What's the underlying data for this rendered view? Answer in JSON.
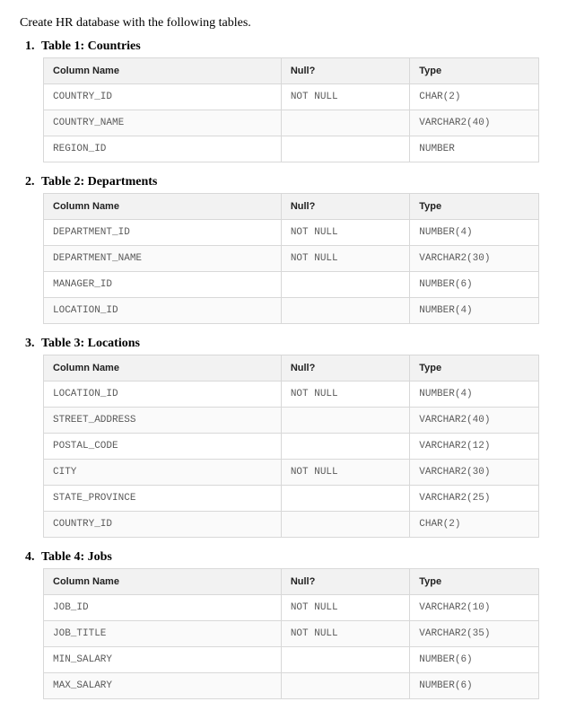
{
  "intro": "Create HR database with the following tables.",
  "tables": [
    {
      "number": "1.",
      "title": "Table 1: Countries",
      "headers": {
        "name": "Column Name",
        "null": "Null?",
        "type": "Type"
      },
      "rows": [
        {
          "name": "COUNTRY_ID",
          "null": "NOT NULL",
          "type": "CHAR(2)"
        },
        {
          "name": "COUNTRY_NAME",
          "null": "",
          "type": "VARCHAR2(40)"
        },
        {
          "name": "REGION_ID",
          "null": "",
          "type": "NUMBER"
        }
      ]
    },
    {
      "number": "2.",
      "title": "Table 2: Departments",
      "headers": {
        "name": "Column Name",
        "null": "Null?",
        "type": "Type"
      },
      "rows": [
        {
          "name": "DEPARTMENT_ID",
          "null": "NOT NULL",
          "type": "NUMBER(4)"
        },
        {
          "name": "DEPARTMENT_NAME",
          "null": "NOT NULL",
          "type": "VARCHAR2(30)"
        },
        {
          "name": "MANAGER_ID",
          "null": "",
          "type": "NUMBER(6)"
        },
        {
          "name": "LOCATION_ID",
          "null": "",
          "type": "NUMBER(4)"
        }
      ]
    },
    {
      "number": "3.",
      "title": "Table 3: Locations",
      "headers": {
        "name": "Column Name",
        "null": "Null?",
        "type": "Type"
      },
      "rows": [
        {
          "name": "LOCATION_ID",
          "null": "NOT NULL",
          "type": "NUMBER(4)"
        },
        {
          "name": "STREET_ADDRESS",
          "null": "",
          "type": "VARCHAR2(40)"
        },
        {
          "name": "POSTAL_CODE",
          "null": "",
          "type": "VARCHAR2(12)"
        },
        {
          "name": "CITY",
          "null": "NOT NULL",
          "type": "VARCHAR2(30)"
        },
        {
          "name": "STATE_PROVINCE",
          "null": "",
          "type": "VARCHAR2(25)"
        },
        {
          "name": "COUNTRY_ID",
          "null": "",
          "type": "CHAR(2)"
        }
      ]
    },
    {
      "number": "4.",
      "title": "Table 4: Jobs",
      "headers": {
        "name": "Column Name",
        "null": "Null?",
        "type": "Type"
      },
      "rows": [
        {
          "name": "JOB_ID",
          "null": "NOT NULL",
          "type": "VARCHAR2(10)"
        },
        {
          "name": "JOB_TITLE",
          "null": "NOT NULL",
          "type": "VARCHAR2(35)"
        },
        {
          "name": "MIN_SALARY",
          "null": "",
          "type": "NUMBER(6)"
        },
        {
          "name": "MAX_SALARY",
          "null": "",
          "type": "NUMBER(6)"
        }
      ]
    }
  ]
}
